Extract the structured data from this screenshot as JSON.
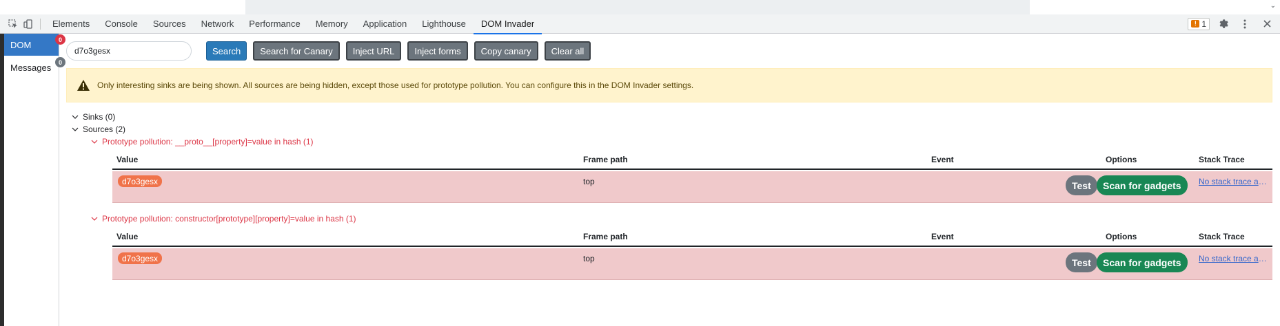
{
  "devtools": {
    "tabs": [
      {
        "label": "Elements"
      },
      {
        "label": "Console"
      },
      {
        "label": "Sources"
      },
      {
        "label": "Network"
      },
      {
        "label": "Performance"
      },
      {
        "label": "Memory"
      },
      {
        "label": "Application"
      },
      {
        "label": "Lighthouse"
      },
      {
        "label": "DOM Invader",
        "active": true
      }
    ],
    "issues_count": "1",
    "icons": [
      "inspect-element-icon",
      "device-toolbar-icon",
      "issues-flag-icon",
      "settings-gear-icon",
      "more-options-icon",
      "close-icon",
      "collapse-caret-icon"
    ]
  },
  "sidebar": {
    "items": [
      {
        "label": "DOM",
        "badge": "0",
        "active": true
      },
      {
        "label": "Messages",
        "badge": "0",
        "active": false
      }
    ]
  },
  "toolbar": {
    "search_value": "d7o3gesx",
    "search_label": "Search",
    "search_canary_label": "Search for Canary",
    "inject_url_label": "Inject URL",
    "inject_forms_label": "Inject forms",
    "copy_canary_label": "Copy canary",
    "clear_all_label": "Clear all"
  },
  "alert": {
    "text": "Only interesting sinks are being shown. All sources are being hidden, except those used for prototype pollution. You can configure this in the DOM Invader settings."
  },
  "tree": {
    "sinks_label": "Sinks (0)",
    "sources_label": "Sources (2)"
  },
  "table_headers": {
    "value": "Value",
    "frame_path": "Frame path",
    "event": "Event",
    "options": "Options",
    "stack_trace": "Stack Trace"
  },
  "groups": [
    {
      "title": "Prototype pollution: __proto__[property]=value in hash (1)",
      "row": {
        "value": "d7o3gesx",
        "frame_path": "top",
        "event": "",
        "test_label": "Test",
        "scan_label": "Scan for gadgets",
        "stack_trace": "No stack trace available"
      }
    },
    {
      "title": "Prototype pollution: constructor[prototype][property]=value in hash (1)",
      "row": {
        "value": "d7o3gesx",
        "frame_path": "top",
        "event": "",
        "test_label": "Test",
        "scan_label": "Scan for gadgets",
        "stack_trace": "No stack trace available"
      }
    }
  ],
  "colors": {
    "accent_blue": "#2a7ab8",
    "danger_red": "#dc3545",
    "row_bg": "#f0c9cb",
    "canary_pill": "#f0734a",
    "scan_green": "#198754",
    "alert_bg": "#fff3cd"
  }
}
